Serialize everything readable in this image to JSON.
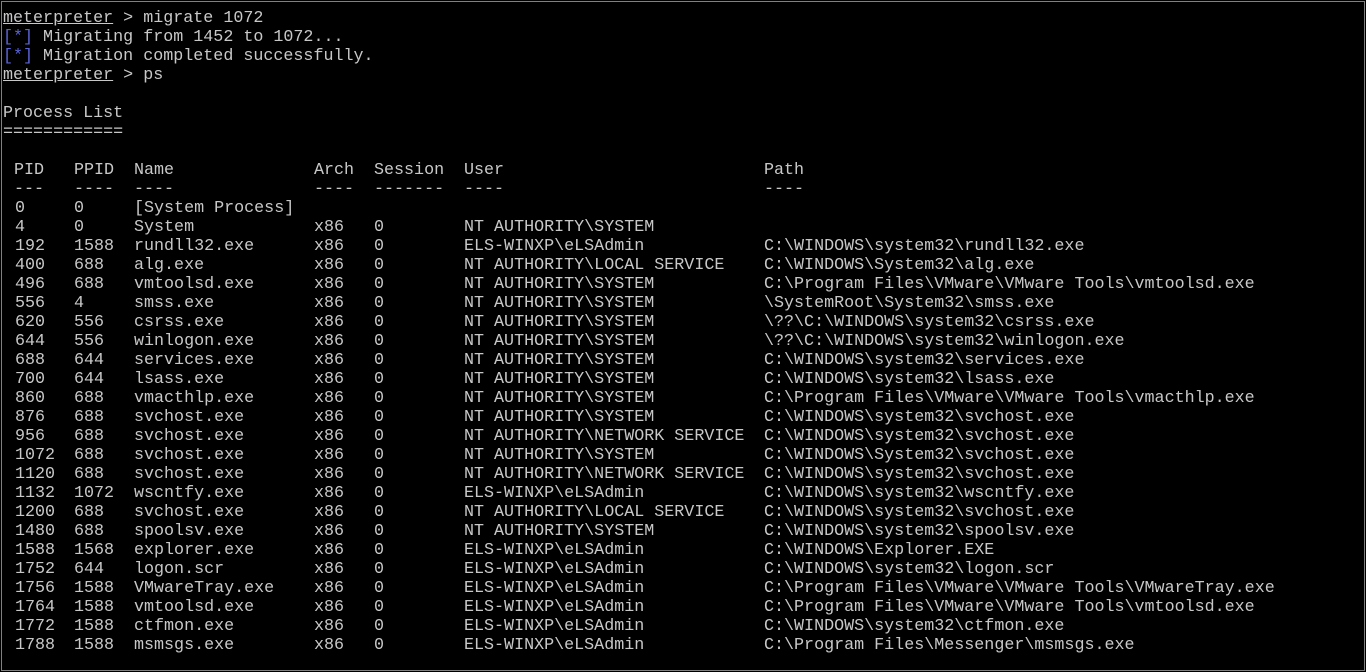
{
  "colors": {
    "background": "#000000",
    "text": "#c8c8c8",
    "status_marker": "#5a63d6",
    "border": "#808080"
  },
  "session": {
    "migrate": {
      "prompt": "meterpreter",
      "separator": " > ",
      "command": "migrate 1072"
    },
    "migrate_messages": [
      {
        "marker": "[*]",
        "text": " Migrating from 1452 to 1072..."
      },
      {
        "marker": "[*]",
        "text": " Migration completed successfully."
      }
    ],
    "ps": {
      "prompt": "meterpreter",
      "separator": " > ",
      "command": "ps"
    },
    "section_title": "Process List",
    "section_underline": "============"
  },
  "process_table": {
    "headers": {
      "pid": "PID",
      "ppid": "PPID",
      "name": "Name",
      "arch": "Arch",
      "session": "Session",
      "user": "User",
      "path": "Path"
    },
    "dashes": {
      "pid": "---",
      "ppid": "----",
      "name": "----",
      "arch": "----",
      "session": "-------",
      "user": "----",
      "path": "----"
    },
    "rows": [
      {
        "pid": "0",
        "ppid": "0",
        "name": "[System Process]",
        "arch": "",
        "session": "",
        "user": "",
        "path": ""
      },
      {
        "pid": "4",
        "ppid": "0",
        "name": "System",
        "arch": "x86",
        "session": "0",
        "user": "NT AUTHORITY\\SYSTEM",
        "path": ""
      },
      {
        "pid": "192",
        "ppid": "1588",
        "name": "rundll32.exe",
        "arch": "x86",
        "session": "0",
        "user": "ELS-WINXP\\eLSAdmin",
        "path": "C:\\WINDOWS\\system32\\rundll32.exe"
      },
      {
        "pid": "400",
        "ppid": "688",
        "name": "alg.exe",
        "arch": "x86",
        "session": "0",
        "user": "NT AUTHORITY\\LOCAL SERVICE",
        "path": "C:\\WINDOWS\\System32\\alg.exe"
      },
      {
        "pid": "496",
        "ppid": "688",
        "name": "vmtoolsd.exe",
        "arch": "x86",
        "session": "0",
        "user": "NT AUTHORITY\\SYSTEM",
        "path": "C:\\Program Files\\VMware\\VMware Tools\\vmtoolsd.exe"
      },
      {
        "pid": "556",
        "ppid": "4",
        "name": "smss.exe",
        "arch": "x86",
        "session": "0",
        "user": "NT AUTHORITY\\SYSTEM",
        "path": "\\SystemRoot\\System32\\smss.exe"
      },
      {
        "pid": "620",
        "ppid": "556",
        "name": "csrss.exe",
        "arch": "x86",
        "session": "0",
        "user": "NT AUTHORITY\\SYSTEM",
        "path": "\\??\\C:\\WINDOWS\\system32\\csrss.exe"
      },
      {
        "pid": "644",
        "ppid": "556",
        "name": "winlogon.exe",
        "arch": "x86",
        "session": "0",
        "user": "NT AUTHORITY\\SYSTEM",
        "path": "\\??\\C:\\WINDOWS\\system32\\winlogon.exe"
      },
      {
        "pid": "688",
        "ppid": "644",
        "name": "services.exe",
        "arch": "x86",
        "session": "0",
        "user": "NT AUTHORITY\\SYSTEM",
        "path": "C:\\WINDOWS\\system32\\services.exe"
      },
      {
        "pid": "700",
        "ppid": "644",
        "name": "lsass.exe",
        "arch": "x86",
        "session": "0",
        "user": "NT AUTHORITY\\SYSTEM",
        "path": "C:\\WINDOWS\\system32\\lsass.exe"
      },
      {
        "pid": "860",
        "ppid": "688",
        "name": "vmacthlp.exe",
        "arch": "x86",
        "session": "0",
        "user": "NT AUTHORITY\\SYSTEM",
        "path": "C:\\Program Files\\VMware\\VMware Tools\\vmacthlp.exe"
      },
      {
        "pid": "876",
        "ppid": "688",
        "name": "svchost.exe",
        "arch": "x86",
        "session": "0",
        "user": "NT AUTHORITY\\SYSTEM",
        "path": "C:\\WINDOWS\\system32\\svchost.exe"
      },
      {
        "pid": "956",
        "ppid": "688",
        "name": "svchost.exe",
        "arch": "x86",
        "session": "0",
        "user": "NT AUTHORITY\\NETWORK SERVICE",
        "path": "C:\\WINDOWS\\system32\\svchost.exe"
      },
      {
        "pid": "1072",
        "ppid": "688",
        "name": "svchost.exe",
        "arch": "x86",
        "session": "0",
        "user": "NT AUTHORITY\\SYSTEM",
        "path": "C:\\WINDOWS\\System32\\svchost.exe"
      },
      {
        "pid": "1120",
        "ppid": "688",
        "name": "svchost.exe",
        "arch": "x86",
        "session": "0",
        "user": "NT AUTHORITY\\NETWORK SERVICE",
        "path": "C:\\WINDOWS\\system32\\svchost.exe"
      },
      {
        "pid": "1132",
        "ppid": "1072",
        "name": "wscntfy.exe",
        "arch": "x86",
        "session": "0",
        "user": "ELS-WINXP\\eLSAdmin",
        "path": "C:\\WINDOWS\\system32\\wscntfy.exe"
      },
      {
        "pid": "1200",
        "ppid": "688",
        "name": "svchost.exe",
        "arch": "x86",
        "session": "0",
        "user": "NT AUTHORITY\\LOCAL SERVICE",
        "path": "C:\\WINDOWS\\system32\\svchost.exe"
      },
      {
        "pid": "1480",
        "ppid": "688",
        "name": "spoolsv.exe",
        "arch": "x86",
        "session": "0",
        "user": "NT AUTHORITY\\SYSTEM",
        "path": "C:\\WINDOWS\\system32\\spoolsv.exe"
      },
      {
        "pid": "1588",
        "ppid": "1568",
        "name": "explorer.exe",
        "arch": "x86",
        "session": "0",
        "user": "ELS-WINXP\\eLSAdmin",
        "path": "C:\\WINDOWS\\Explorer.EXE"
      },
      {
        "pid": "1752",
        "ppid": "644",
        "name": "logon.scr",
        "arch": "x86",
        "session": "0",
        "user": "ELS-WINXP\\eLSAdmin",
        "path": "C:\\WINDOWS\\system32\\logon.scr"
      },
      {
        "pid": "1756",
        "ppid": "1588",
        "name": "VMwareTray.exe",
        "arch": "x86",
        "session": "0",
        "user": "ELS-WINXP\\eLSAdmin",
        "path": "C:\\Program Files\\VMware\\VMware Tools\\VMwareTray.exe"
      },
      {
        "pid": "1764",
        "ppid": "1588",
        "name": "vmtoolsd.exe",
        "arch": "x86",
        "session": "0",
        "user": "ELS-WINXP\\eLSAdmin",
        "path": "C:\\Program Files\\VMware\\VMware Tools\\vmtoolsd.exe"
      },
      {
        "pid": "1772",
        "ppid": "1588",
        "name": "ctfmon.exe",
        "arch": "x86",
        "session": "0",
        "user": "ELS-WINXP\\eLSAdmin",
        "path": "C:\\WINDOWS\\system32\\ctfmon.exe"
      },
      {
        "pid": "1788",
        "ppid": "1588",
        "name": "msmsgs.exe",
        "arch": "x86",
        "session": "0",
        "user": "ELS-WINXP\\eLSAdmin",
        "path": "C:\\Program Files\\Messenger\\msmsgs.exe"
      }
    ]
  }
}
